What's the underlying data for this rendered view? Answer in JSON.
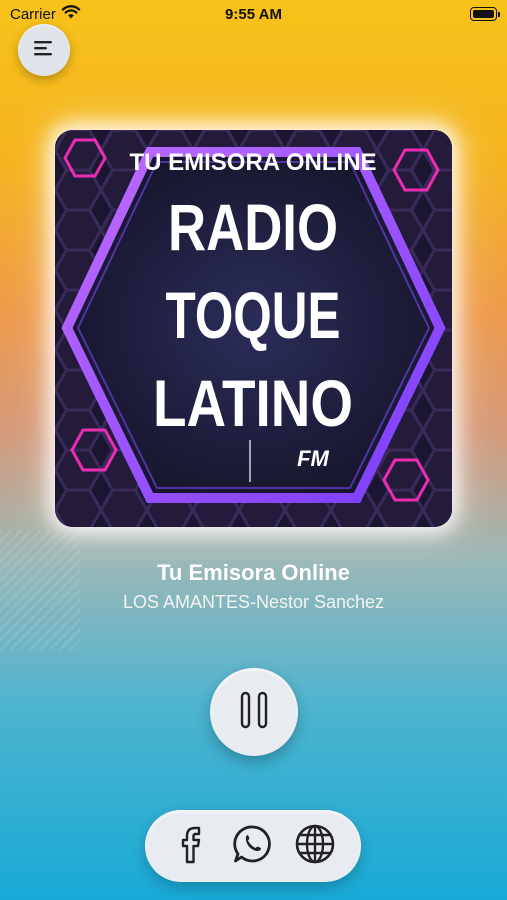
{
  "status": {
    "carrier": "Carrier",
    "time": "9:55 AM"
  },
  "artwork": {
    "tagline": "TU EMISORA ONLINE",
    "line1": "RADIO",
    "line2": "TOQUE",
    "line3": "LATINO",
    "suffix": "FM"
  },
  "now_playing": {
    "station": "Tu Emisora Online",
    "track": "LOS AMANTES-Nestor Sanchez"
  },
  "controls": {
    "play_state": "playing",
    "icon": "pause-icon"
  },
  "social": [
    {
      "name": "facebook",
      "icon": "facebook-icon"
    },
    {
      "name": "whatsapp",
      "icon": "whatsapp-icon"
    },
    {
      "name": "website",
      "icon": "globe-icon"
    }
  ],
  "colors": {
    "accent_purple": "#b15cff",
    "hex_pink": "#ff2fc0"
  }
}
